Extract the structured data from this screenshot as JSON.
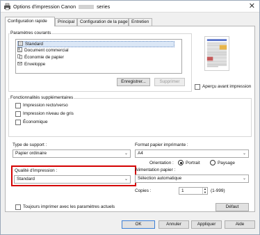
{
  "window": {
    "title_prefix": "Options d'impression Canon",
    "title_suffix": "series",
    "close_glyph": "✕"
  },
  "tabs": [
    {
      "label": "Configuration rapide"
    },
    {
      "label": "Principal"
    },
    {
      "label": "Configuration de la page"
    },
    {
      "label": "Entretien"
    }
  ],
  "common_settings": {
    "legend": "Paramètres courants",
    "items": [
      {
        "label": "Standard",
        "icon": "standard-doc-icon"
      },
      {
        "label": "Document commercial",
        "icon": "business-doc-icon"
      },
      {
        "label": "Économie de papier",
        "icon": "paper-saving-icon"
      },
      {
        "label": "Enveloppe",
        "icon": "envelope-icon"
      }
    ],
    "selected": "Standard",
    "save_button": "Enregistrer...",
    "delete_button": "Supprimer"
  },
  "preview": {
    "label": "Aperçu avant impression",
    "checked": false
  },
  "additional_features": {
    "legend": "Fonctionnalités supplémentaires",
    "items": [
      {
        "label": "Impression recto/verso",
        "checked": false
      },
      {
        "label": "Impression niveau de gris",
        "checked": false
      },
      {
        "label": "Économique",
        "checked": false
      }
    ]
  },
  "media_type": {
    "label": "Type de support :",
    "value": "Papier ordinaire"
  },
  "printer_paper_size": {
    "label": "Format papier imprimante :",
    "value": "A4"
  },
  "orientation": {
    "label": "Orientation :",
    "portrait": "Portrait",
    "landscape": "Paysage",
    "selected": "Portrait"
  },
  "print_quality": {
    "label": "Qualité d'impression :",
    "value": "Standard"
  },
  "paper_source": {
    "label": "Alimentation papier :",
    "value": "Sélection automatique"
  },
  "copies": {
    "label": "Copies :",
    "value": "1",
    "range": "(1-999)"
  },
  "always_print": {
    "label": "Toujours imprimer avec les paramètres actuels",
    "checked": false
  },
  "defaults_button": "Défaut",
  "footer": {
    "ok": "OK",
    "cancel": "Annuler",
    "apply": "Appliquer",
    "help": "Aide"
  },
  "colors": {
    "highlight": "#d40000",
    "selection": "#dbe7f6",
    "primary_border": "#3c7fd6"
  }
}
